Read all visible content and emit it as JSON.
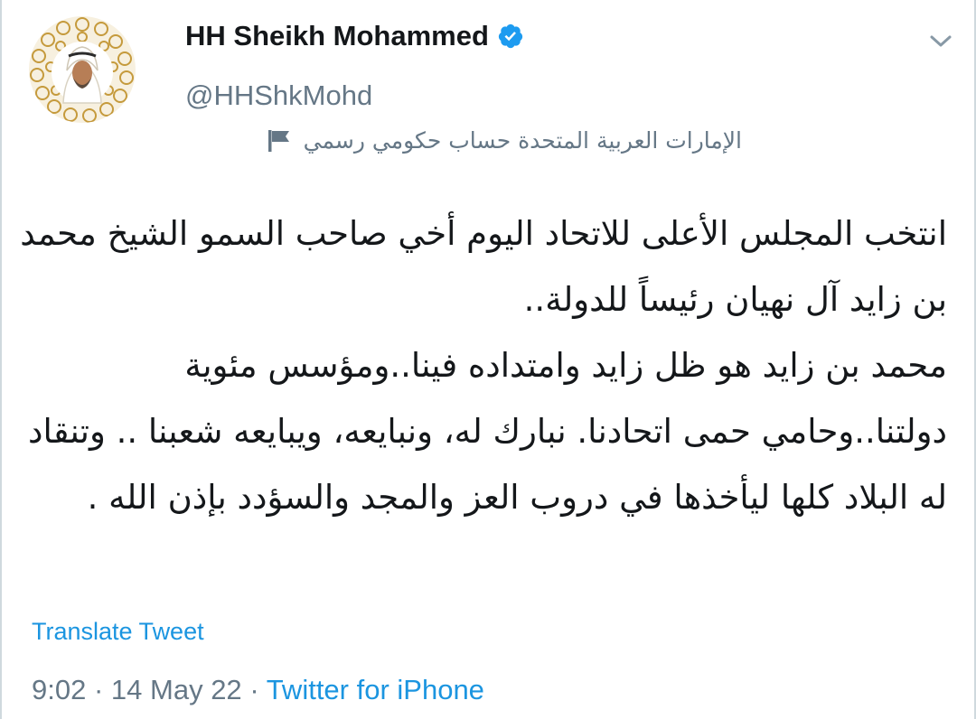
{
  "tweet": {
    "author_name": "HH Sheikh Mohammed",
    "handle": "@HHShkMohd",
    "account_label": "الإمارات العربية المتحدة حساب حكومي رسمي",
    "body": "انتخب المجلس الأعلى للاتحاد اليوم أخي صاحب السمو الشيخ محمد بن زايد آل نهيان رئيساً للدولة..\nمحمد بن زايد هو ظل زايد وامتداده فينا..ومؤسس مئوية دولتنا..وحامي حمى اتحادنا. نبارك له، ونبايعه، ويبايعه شعبنا .. وتنقاد له البلاد كلها ليأخذها في دروب العز والمجد والسؤدد بإذن الله .",
    "translate_label": "Translate Tweet",
    "time": "9:02",
    "date": "14 May 22",
    "separator": "·",
    "source": "Twitter for iPhone"
  },
  "icons": {
    "verified": "verified-badge-icon",
    "caret": "chevron-down-icon",
    "label_flag": "flag-icon"
  },
  "colors": {
    "accent": "#1b95e0",
    "verified": "#1d9bf0",
    "secondary_text": "#657786",
    "primary_text": "#14171a"
  }
}
